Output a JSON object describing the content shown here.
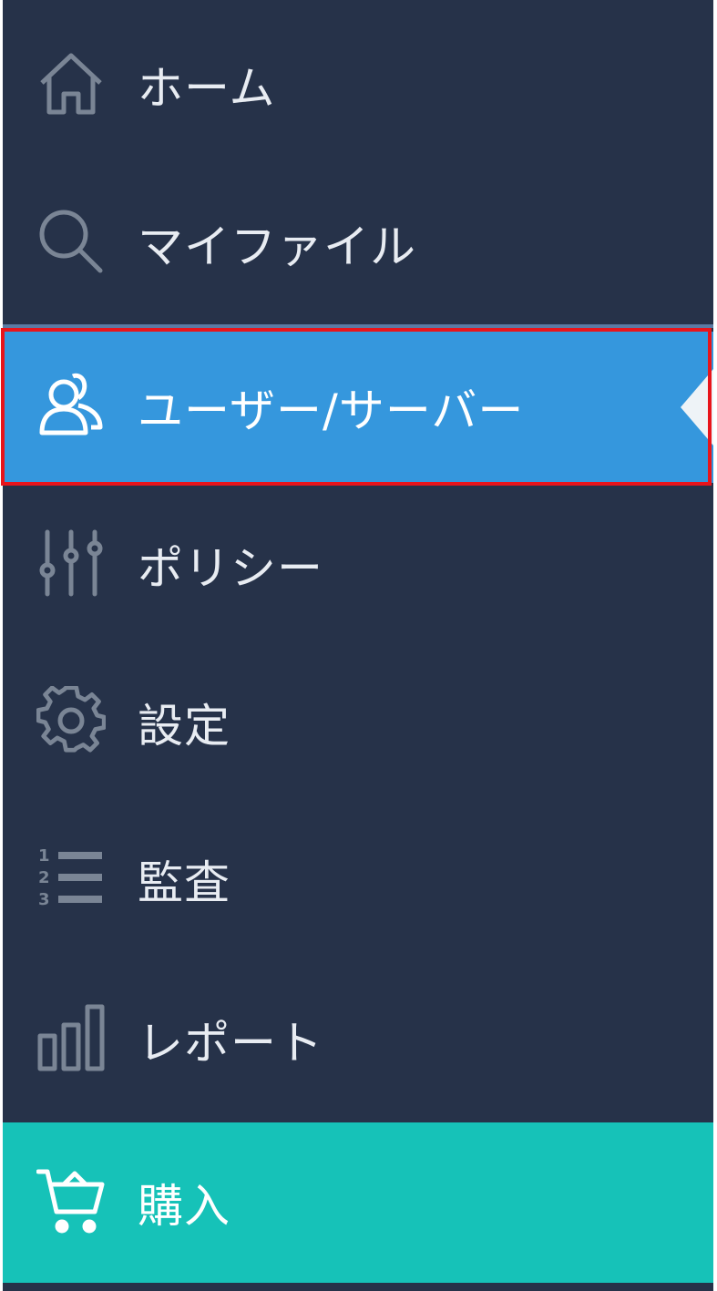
{
  "sidebar": {
    "items": [
      {
        "id": "home",
        "label": "ホーム",
        "icon": "home-icon"
      },
      {
        "id": "my-files",
        "label": "マイファイル",
        "icon": "search-icon"
      },
      {
        "id": "users-servers",
        "label": "ユーザー/サーバー",
        "icon": "users-icon",
        "active": true
      },
      {
        "id": "policy",
        "label": "ポリシー",
        "icon": "sliders-icon"
      },
      {
        "id": "settings",
        "label": "設定",
        "icon": "gear-icon"
      },
      {
        "id": "audit",
        "label": "監査",
        "icon": "numbered-list-icon"
      },
      {
        "id": "reports",
        "label": "レポート",
        "icon": "bar-chart-icon"
      },
      {
        "id": "purchase",
        "label": "購入",
        "icon": "cart-icon"
      }
    ]
  },
  "colors": {
    "sidebar_bg": "#263249",
    "active_bg": "#3597dd",
    "purchase_bg": "#16c2b8",
    "icon_color": "#7a8595",
    "highlight_border": "#e8141b"
  }
}
